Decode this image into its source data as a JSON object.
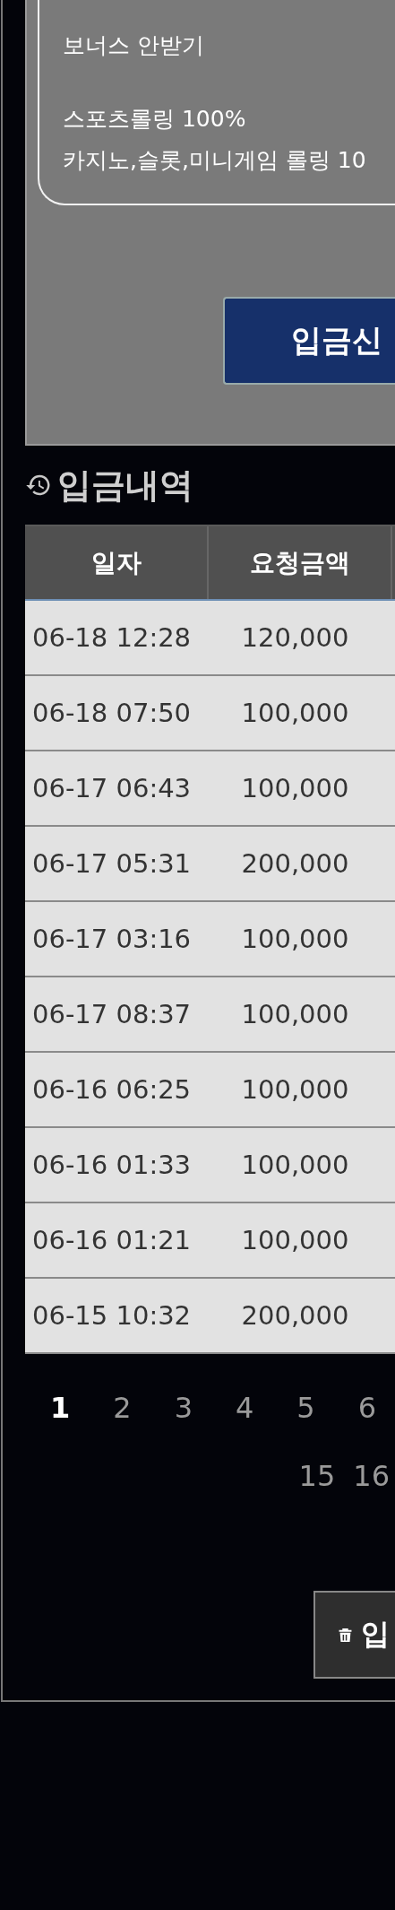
{
  "bonus_box": {
    "paragraphs": [
      [
        "보너스 안받기"
      ],
      [
        "스포츠롤링 100%",
        "카지노,슬롯,미니게임 롤링 10"
      ]
    ]
  },
  "submit_button": {
    "label": "입금신"
  },
  "history": {
    "title": "입금내역",
    "columns": [
      "일자",
      "요청금액"
    ],
    "rows": [
      {
        "date": "06-18 12:28",
        "amount": "120,000"
      },
      {
        "date": "06-18 07:50",
        "amount": "100,000"
      },
      {
        "date": "06-17 06:43",
        "amount": "100,000"
      },
      {
        "date": "06-17 05:31",
        "amount": "200,000"
      },
      {
        "date": "06-17 03:16",
        "amount": "100,000"
      },
      {
        "date": "06-17 08:37",
        "amount": "100,000"
      },
      {
        "date": "06-16 06:25",
        "amount": "100,000"
      },
      {
        "date": "06-16 01:33",
        "amount": "100,000"
      },
      {
        "date": "06-16 01:21",
        "amount": "100,000"
      },
      {
        "date": "06-15 10:32",
        "amount": "200,000"
      }
    ],
    "pagination": [
      [
        {
          "label": "1",
          "selected": true
        },
        {
          "label": "2",
          "selected": false
        },
        {
          "label": "3",
          "selected": false
        },
        {
          "label": "4",
          "selected": false
        },
        {
          "label": "5",
          "selected": false
        },
        {
          "label": "6",
          "selected": false
        }
      ],
      [
        {
          "label": "15",
          "selected": false
        },
        {
          "label": "16",
          "selected": false
        }
      ]
    ],
    "delete_button": {
      "label": "입"
    }
  }
}
